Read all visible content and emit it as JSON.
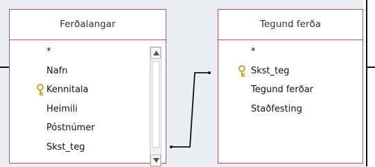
{
  "tables": [
    {
      "title": "Ferðalangar",
      "fields": [
        "*",
        "Nafn",
        "Kennitala",
        "Heimili",
        "Póstnúmer",
        "Skst_teg"
      ],
      "primary_key_field": "Kennitala",
      "has_scrollbar": true
    },
    {
      "title": "Tegund ferða",
      "fields": [
        "*",
        "Skst_teg",
        "Tegund ferðar",
        "Staðfesting"
      ],
      "primary_key_field": "Skst_teg",
      "has_scrollbar": false
    }
  ],
  "relationship": {
    "from": "Ferðalangar.Skst_teg",
    "to": "Tegund ferða.Skst_teg"
  },
  "icons": {
    "key": "key-icon",
    "scroll_up": "triangle-up-icon",
    "scroll_down": "triangle-down-icon"
  },
  "colors": {
    "table_border": "#a8505f",
    "background": "#ebeef2",
    "key": "#c8a020"
  }
}
